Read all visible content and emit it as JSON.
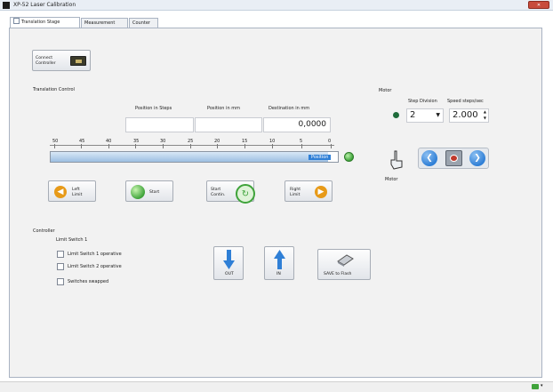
{
  "window": {
    "title": "XP-52 Laser Calibration"
  },
  "tabs": [
    {
      "label": "Translation Stage",
      "active": true
    },
    {
      "label": "Measurement",
      "active": false
    },
    {
      "label": "Counter",
      "active": false
    }
  ],
  "connect_button": {
    "label_line1": "Connect",
    "label_line2": "Controller"
  },
  "translation": {
    "group_title": "Translation Control",
    "col_steps": "Position in Steps",
    "col_mm": "Position in mm",
    "col_dest": "Destination in mm",
    "position_steps_value": "",
    "position_mm_value": "",
    "destination_value": "0,0000",
    "scale_ticks": [
      "50",
      "45",
      "40",
      "35",
      "30",
      "25",
      "20",
      "15",
      "10",
      "5",
      "0"
    ],
    "slider_handle": "Position",
    "buttons": {
      "left_limit_line1": "Left",
      "left_limit_line2": "Limit",
      "start": "Start",
      "start_cont_line1": "Start",
      "start_cont_line2": "Contin.",
      "right_limit_line1": "Right",
      "right_limit_line2": "Limit"
    }
  },
  "motor": {
    "group_title": "Motor",
    "col_step": "Step Division",
    "col_speed": "Speed steps/sec",
    "step_division": "2",
    "speed": "2.000",
    "label": "Motor"
  },
  "controller": {
    "group_title": "Controller",
    "sub_title": "Limit Switch 1",
    "checks": [
      {
        "label": "Limit Switch 1 operative",
        "checked": false
      },
      {
        "label": "Limit Switch 2 operative",
        "checked": false
      },
      {
        "label": "Switches swapped",
        "checked": false
      }
    ],
    "out_label": "OUT",
    "in_label": "IN",
    "save_label": "SAVE to Flash"
  },
  "colors": {
    "accent_blue": "#2f7fd6",
    "led_green": "#3fa33a",
    "icon_orange": "#e79a19",
    "stop_red": "#c0392b"
  }
}
